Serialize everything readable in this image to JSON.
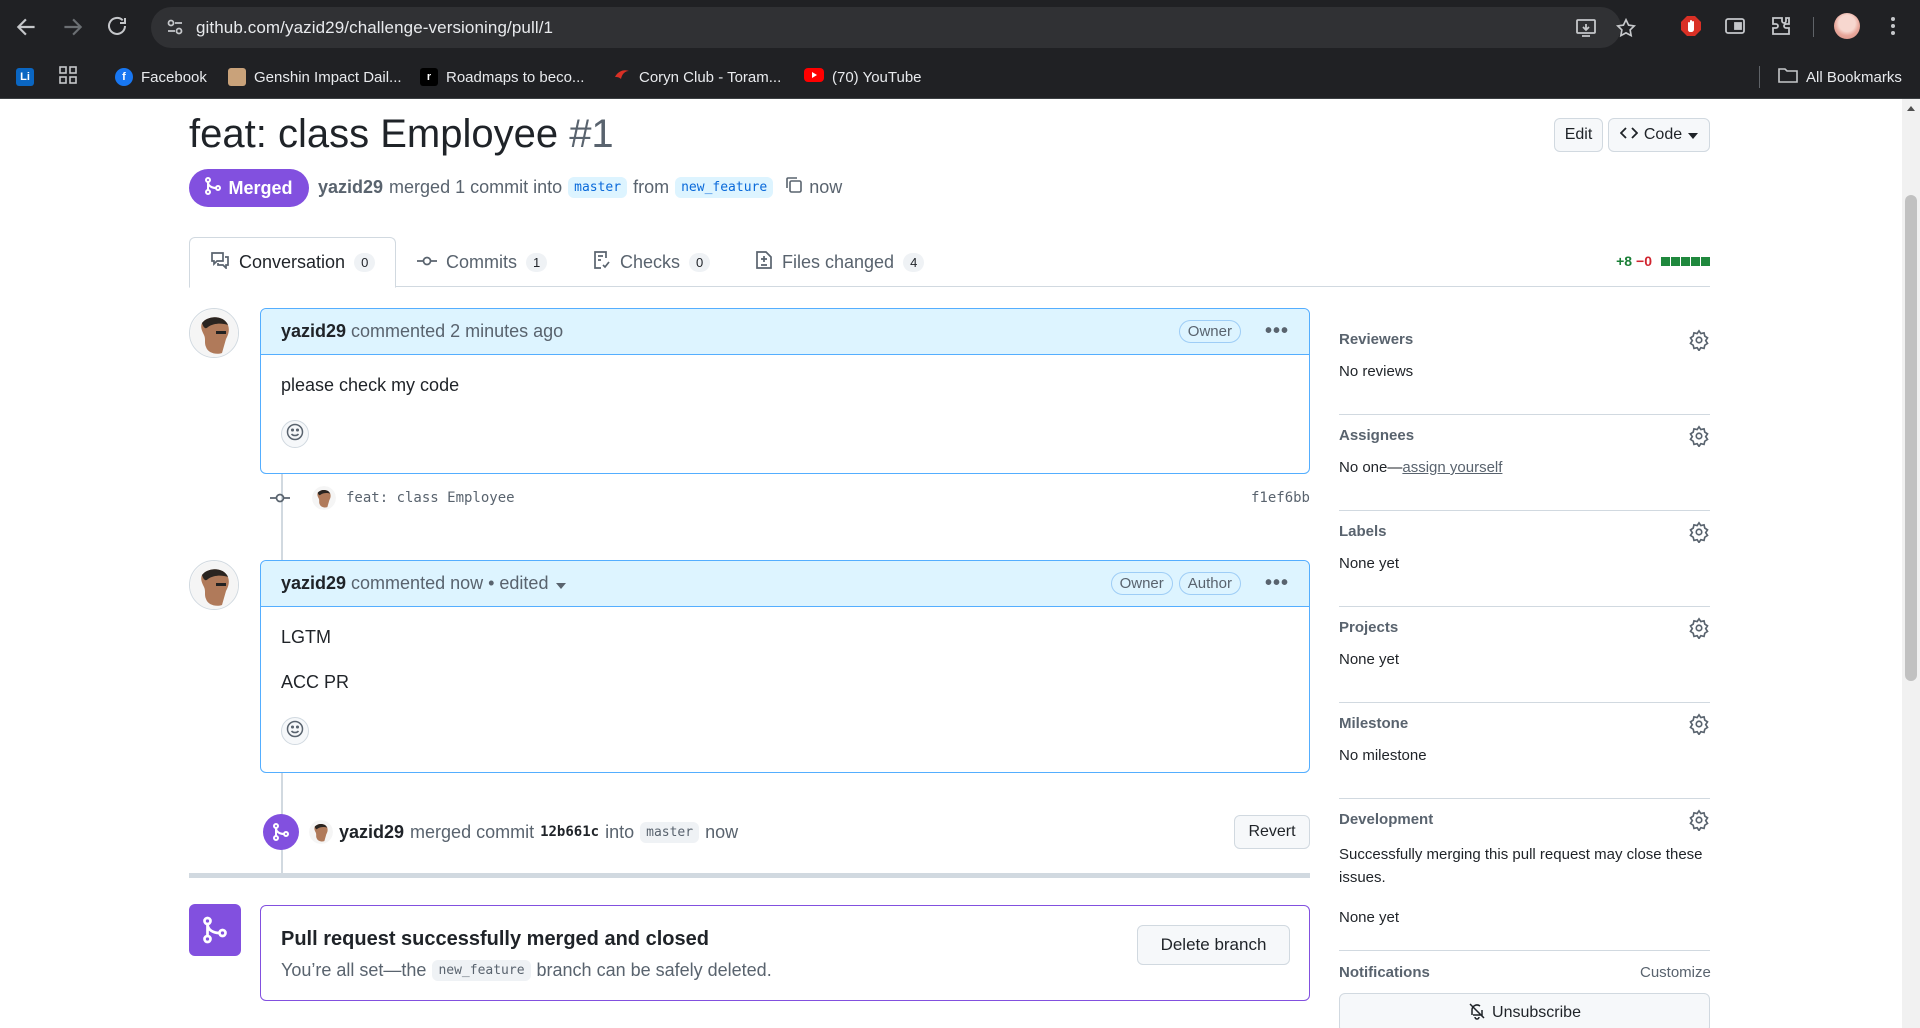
{
  "browser": {
    "url": "github.com/yazid29/challenge-versioning/pull/1",
    "bookmarks": [
      {
        "label": "",
        "icon": "linkedin-icon",
        "ico_text": "Li",
        "color": "#0a66c2"
      },
      {
        "label": "",
        "icon": "apps-grid-icon"
      },
      {
        "label": "Facebook",
        "icon": "facebook-icon",
        "ico_text": "f",
        "color": "#1877f2"
      },
      {
        "label": "Genshin Impact Dail...",
        "icon": "genshin-icon",
        "color": "#c9a27a"
      },
      {
        "label": "Roadmaps to beco...",
        "icon": "roadmap-icon",
        "ico_text": "r",
        "color": "#000000"
      },
      {
        "label": "Coryn Club - Toram...",
        "icon": "coryn-icon",
        "color": "#d93025"
      },
      {
        "label": "(70) YouTube",
        "icon": "youtube-icon",
        "color": "#ff0000"
      }
    ],
    "all_bookmarks": "All Bookmarks"
  },
  "pr": {
    "title": "feat: class Employee",
    "number": "#1",
    "edit_label": "Edit",
    "code_label": "Code",
    "status": "Merged",
    "author": "yazid29",
    "merged_text": "merged 1 commit into",
    "base_branch": "master",
    "from_text": "from",
    "head_branch": "new_feature",
    "time": "now"
  },
  "tabs": [
    {
      "label": "Conversation",
      "count": "0",
      "icon": "comment-discussion-icon"
    },
    {
      "label": "Commits",
      "count": "1",
      "icon": "commit-icon"
    },
    {
      "label": "Checks",
      "count": "0",
      "icon": "checklist-icon"
    },
    {
      "label": "Files changed",
      "count": "4",
      "icon": "file-diff-icon"
    }
  ],
  "diffstat": {
    "additions": "+8",
    "deletions": "−0"
  },
  "comments": [
    {
      "author": "yazid29",
      "meta": "commented 2 minutes ago",
      "roles": [
        "Owner"
      ],
      "body": [
        "please check my code"
      ]
    },
    {
      "author": "yazid29",
      "meta": "commented now • edited",
      "roles": [
        "Owner",
        "Author"
      ],
      "body": [
        "LGTM",
        "ACC PR"
      ]
    }
  ],
  "commit": {
    "message": "feat: class Employee",
    "sha": "f1ef6bb"
  },
  "merge_event": {
    "author": "yazid29",
    "text": "merged commit",
    "sha": "12b661c",
    "into": "into",
    "branch": "master",
    "time": "now",
    "revert_label": "Revert"
  },
  "merged_box": {
    "title": "Pull request successfully merged and closed",
    "text_before": "You’re all set—the",
    "branch": "new_feature",
    "text_after": "branch can be safely deleted.",
    "delete_label": "Delete branch"
  },
  "sidebar": {
    "sections": [
      {
        "heading": "Reviewers",
        "value": "No reviews"
      },
      {
        "heading": "Assignees",
        "value": "No one—",
        "link": "assign yourself"
      },
      {
        "heading": "Labels",
        "value": "None yet"
      },
      {
        "heading": "Projects",
        "value": "None yet"
      },
      {
        "heading": "Milestone",
        "value": "No milestone"
      }
    ],
    "development": {
      "heading": "Development",
      "text": "Successfully merging this pull request may close these issues.",
      "value": "None yet"
    },
    "notifications": {
      "heading": "Notifications",
      "customize": "Customize",
      "unsubscribe": "Unsubscribe"
    }
  },
  "colors": {
    "merged": "#8250df",
    "link": "#0969da",
    "comment_border": "#54aeff",
    "diff_add": "#1a7f37",
    "diff_del": "#d1242f"
  }
}
